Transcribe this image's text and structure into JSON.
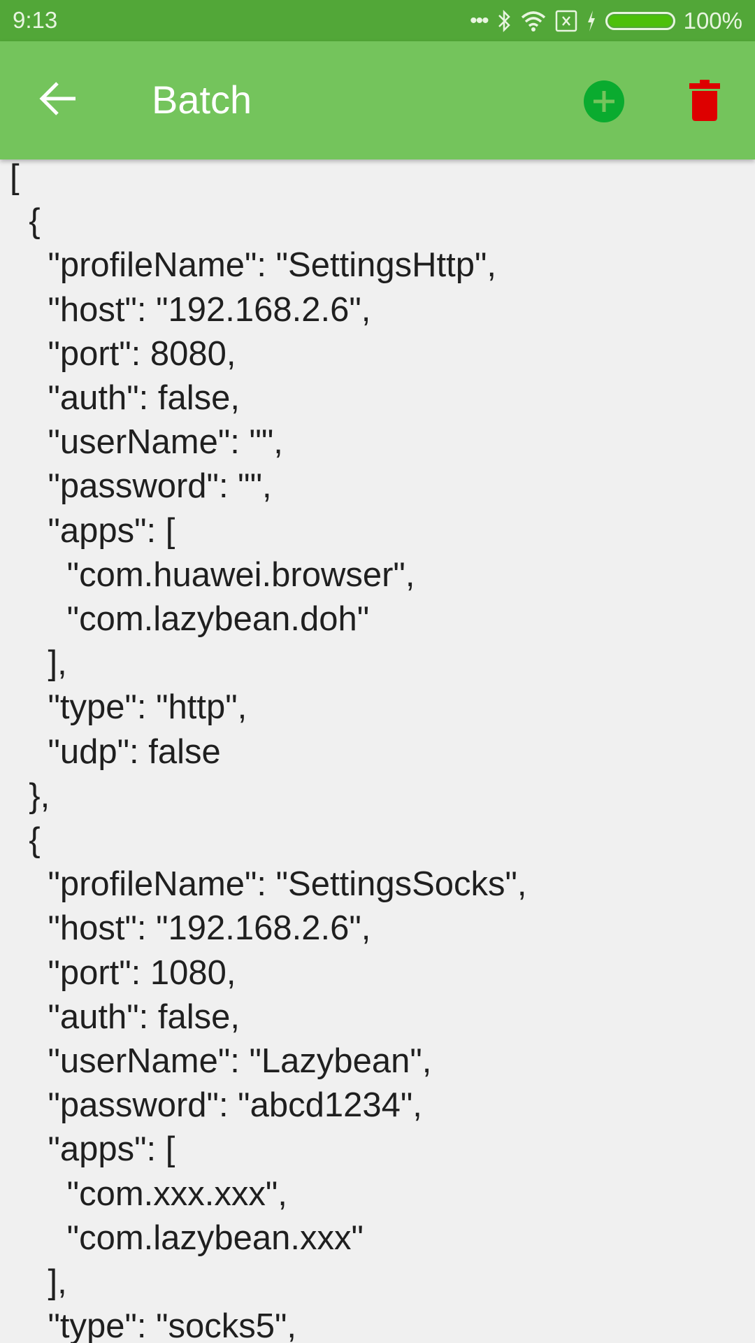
{
  "status_bar": {
    "time": "9:13",
    "icons": [
      "more-dots-icon",
      "bluetooth-icon",
      "wifi-icon",
      "sim-off-icon",
      "charging-icon",
      "battery-icon"
    ],
    "battery_percent": "100%",
    "battery_level": 1.0
  },
  "app_bar": {
    "title": "Batch",
    "back_icon": "arrow-left-icon",
    "add_icon": "plus-circle-icon",
    "delete_icon": "trash-icon",
    "colors": {
      "status_bar": "#52a738",
      "app_bar": "#74c45c",
      "add": "#0aab2f",
      "delete": "#dd0000"
    }
  },
  "content": {
    "lines": [
      "[",
      "  {",
      "    \"profileName\": \"SettingsHttp\",",
      "    \"host\": \"192.168.2.6\",",
      "    \"port\": 8080,",
      "    \"auth\": false,",
      "    \"userName\": \"\",",
      "    \"password\": \"\",",
      "    \"apps\": [",
      "      \"com.huawei.browser\",",
      "      \"com.lazybean.doh\"",
      "    ],",
      "    \"type\": \"http\",",
      "    \"udp\": false",
      "  },",
      "  {",
      "    \"profileName\": \"SettingsSocks\",",
      "    \"host\": \"192.168.2.6\",",
      "    \"port\": 1080,",
      "    \"auth\": false,",
      "    \"userName\": \"Lazybean\",",
      "    \"password\": \"abcd1234\",",
      "    \"apps\": [",
      "      \"com.xxx.xxx\",",
      "      \"com.lazybean.xxx\"",
      "    ],",
      "    \"type\": \"socks5\","
    ]
  }
}
